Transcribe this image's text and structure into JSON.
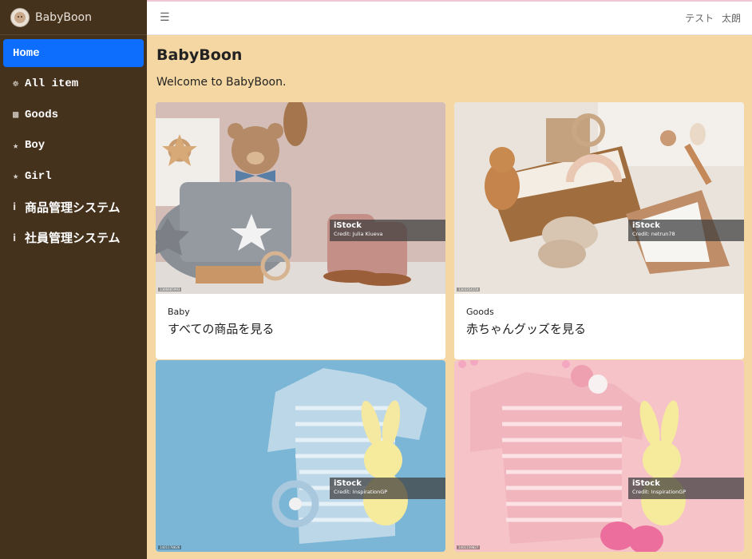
{
  "brand": {
    "name": "BabyBoon"
  },
  "header": {
    "menu_icon": "hamburger-icon",
    "user": "テスト 太朗"
  },
  "sidebar": {
    "items": [
      {
        "label": "Home",
        "icon": "",
        "active": true
      },
      {
        "label": "All item",
        "icon": "stroller-icon"
      },
      {
        "label": "Goods",
        "icon": "gift-icon"
      },
      {
        "label": "Boy",
        "icon": "star-icon"
      },
      {
        "label": "Girl",
        "icon": "star-icon"
      },
      {
        "label": "商品管理システム",
        "icon": "info-icon"
      },
      {
        "label": "社員管理システム",
        "icon": "info-icon"
      }
    ]
  },
  "main": {
    "title": "BabyBoon",
    "welcome": "Welcome to BabyBoon.",
    "cards": [
      {
        "subtitle": "Baby",
        "title": "すべての商品を見る",
        "istock": "iStock",
        "credit": "Credit: Julia Kiueva",
        "stock_id": "1386865993"
      },
      {
        "subtitle": "Goods",
        "title": "赤ちゃんグッズを見る",
        "istock": "iStock",
        "credit": "Credit: netrun78",
        "stock_id": "1303354154"
      },
      {
        "subtitle": "",
        "title": "",
        "istock": "iStock",
        "credit": "Credit: InspirationGP",
        "stock_id": "1401178626"
      },
      {
        "subtitle": "",
        "title": "",
        "istock": "iStock",
        "credit": "Credit: InspirationGP",
        "stock_id": "1401159827"
      }
    ]
  },
  "colors": {
    "sidebar_bg": "#45321d",
    "page_bg": "#f4d7a2",
    "active": "#0d6efd"
  }
}
